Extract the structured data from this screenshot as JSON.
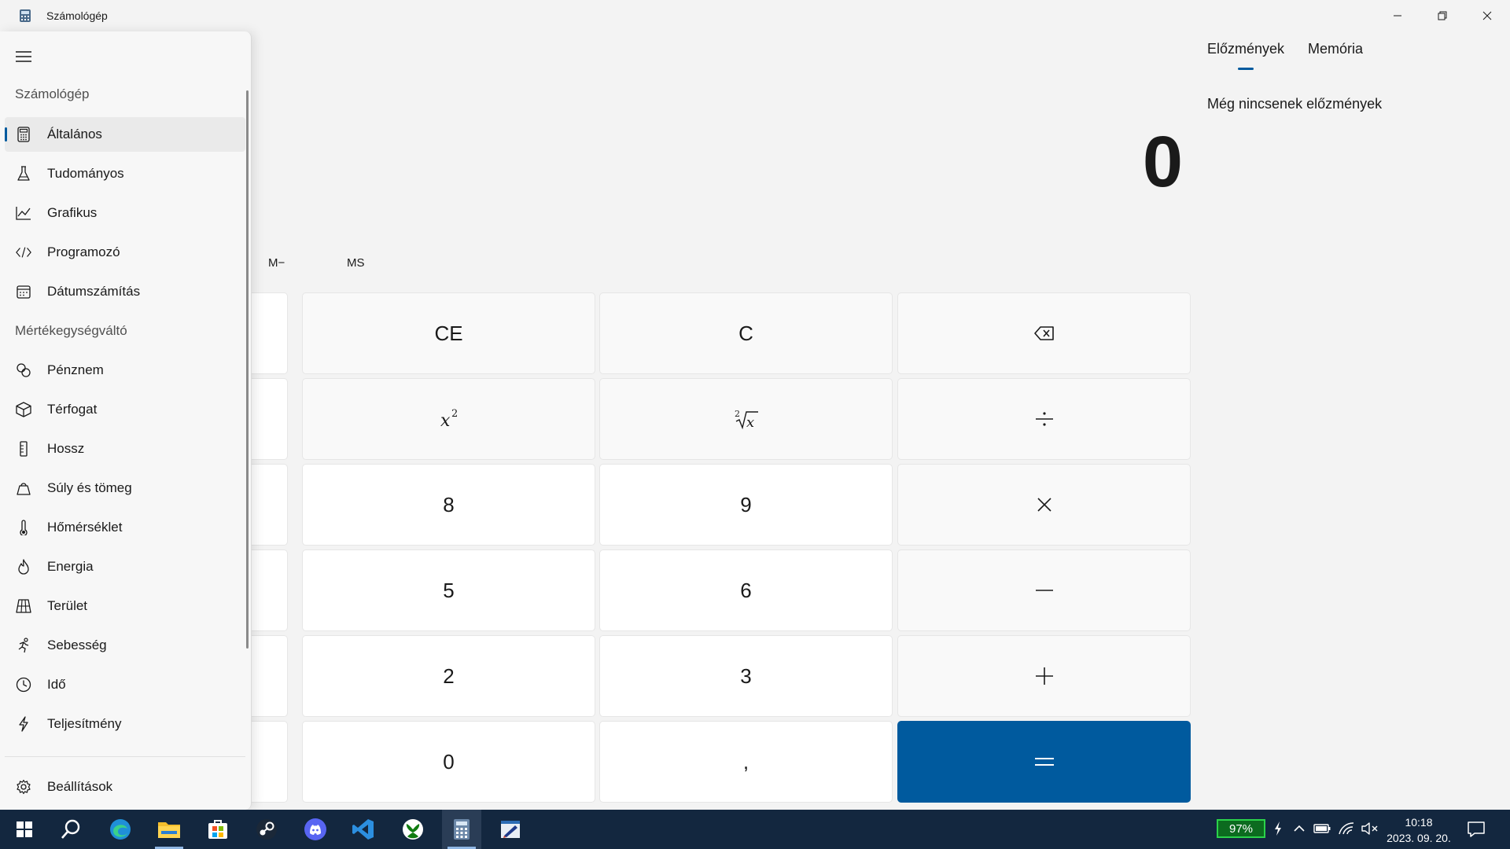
{
  "window": {
    "title": "Számológép"
  },
  "history": {
    "tabs": [
      {
        "label": "Előzmények",
        "active": true
      },
      {
        "label": "Memória",
        "active": false
      }
    ],
    "empty_text": "Még nincsenek előzmények"
  },
  "display": {
    "value": "0"
  },
  "memory": {
    "mminus": "M−",
    "ms": "MS"
  },
  "keys": {
    "ce": "CE",
    "c": "C",
    "eight": "8",
    "nine": "9",
    "five": "5",
    "six": "6",
    "two": "2",
    "three": "3",
    "zero": "0",
    "decimal": ","
  },
  "sidebar": {
    "section_calc": "Számológép",
    "calc_items": [
      {
        "label": "Általános",
        "icon": "calculator-icon",
        "selected": true
      },
      {
        "label": "Tudományos",
        "icon": "flask-icon"
      },
      {
        "label": "Grafikus",
        "icon": "graph-icon"
      },
      {
        "label": "Programozó",
        "icon": "code-icon"
      },
      {
        "label": "Dátumszámítás",
        "icon": "calendar-icon"
      }
    ],
    "section_conv": "Mértékegységváltó",
    "conv_items": [
      {
        "label": "Pénznem",
        "icon": "currency-icon"
      },
      {
        "label": "Térfogat",
        "icon": "cube-icon"
      },
      {
        "label": "Hossz",
        "icon": "ruler-icon"
      },
      {
        "label": "Súly és tömeg",
        "icon": "weight-icon"
      },
      {
        "label": "Hőmérséklet",
        "icon": "thermometer-icon"
      },
      {
        "label": "Energia",
        "icon": "flame-icon"
      },
      {
        "label": "Terület",
        "icon": "grid-icon"
      },
      {
        "label": "Sebesség",
        "icon": "runner-icon"
      },
      {
        "label": "Idő",
        "icon": "clock-icon"
      },
      {
        "label": "Teljesítmény",
        "icon": "lightning-icon"
      }
    ],
    "settings": {
      "label": "Beállítások",
      "icon": "gear-icon"
    }
  },
  "taskbar": {
    "apps": [
      "start-icon",
      "search-icon",
      "edge-icon",
      "file-explorer-icon",
      "store-icon",
      "steam-icon",
      "discord-icon",
      "vscode-icon",
      "xbox-icon",
      "calculator-icon",
      "paint-icon"
    ],
    "battery": "97%",
    "time": "10:18",
    "date": "2023. 09. 20."
  },
  "colors": {
    "accent": "#005a9e",
    "taskbar": "#13273f",
    "battery_green": "#2bd24a"
  }
}
